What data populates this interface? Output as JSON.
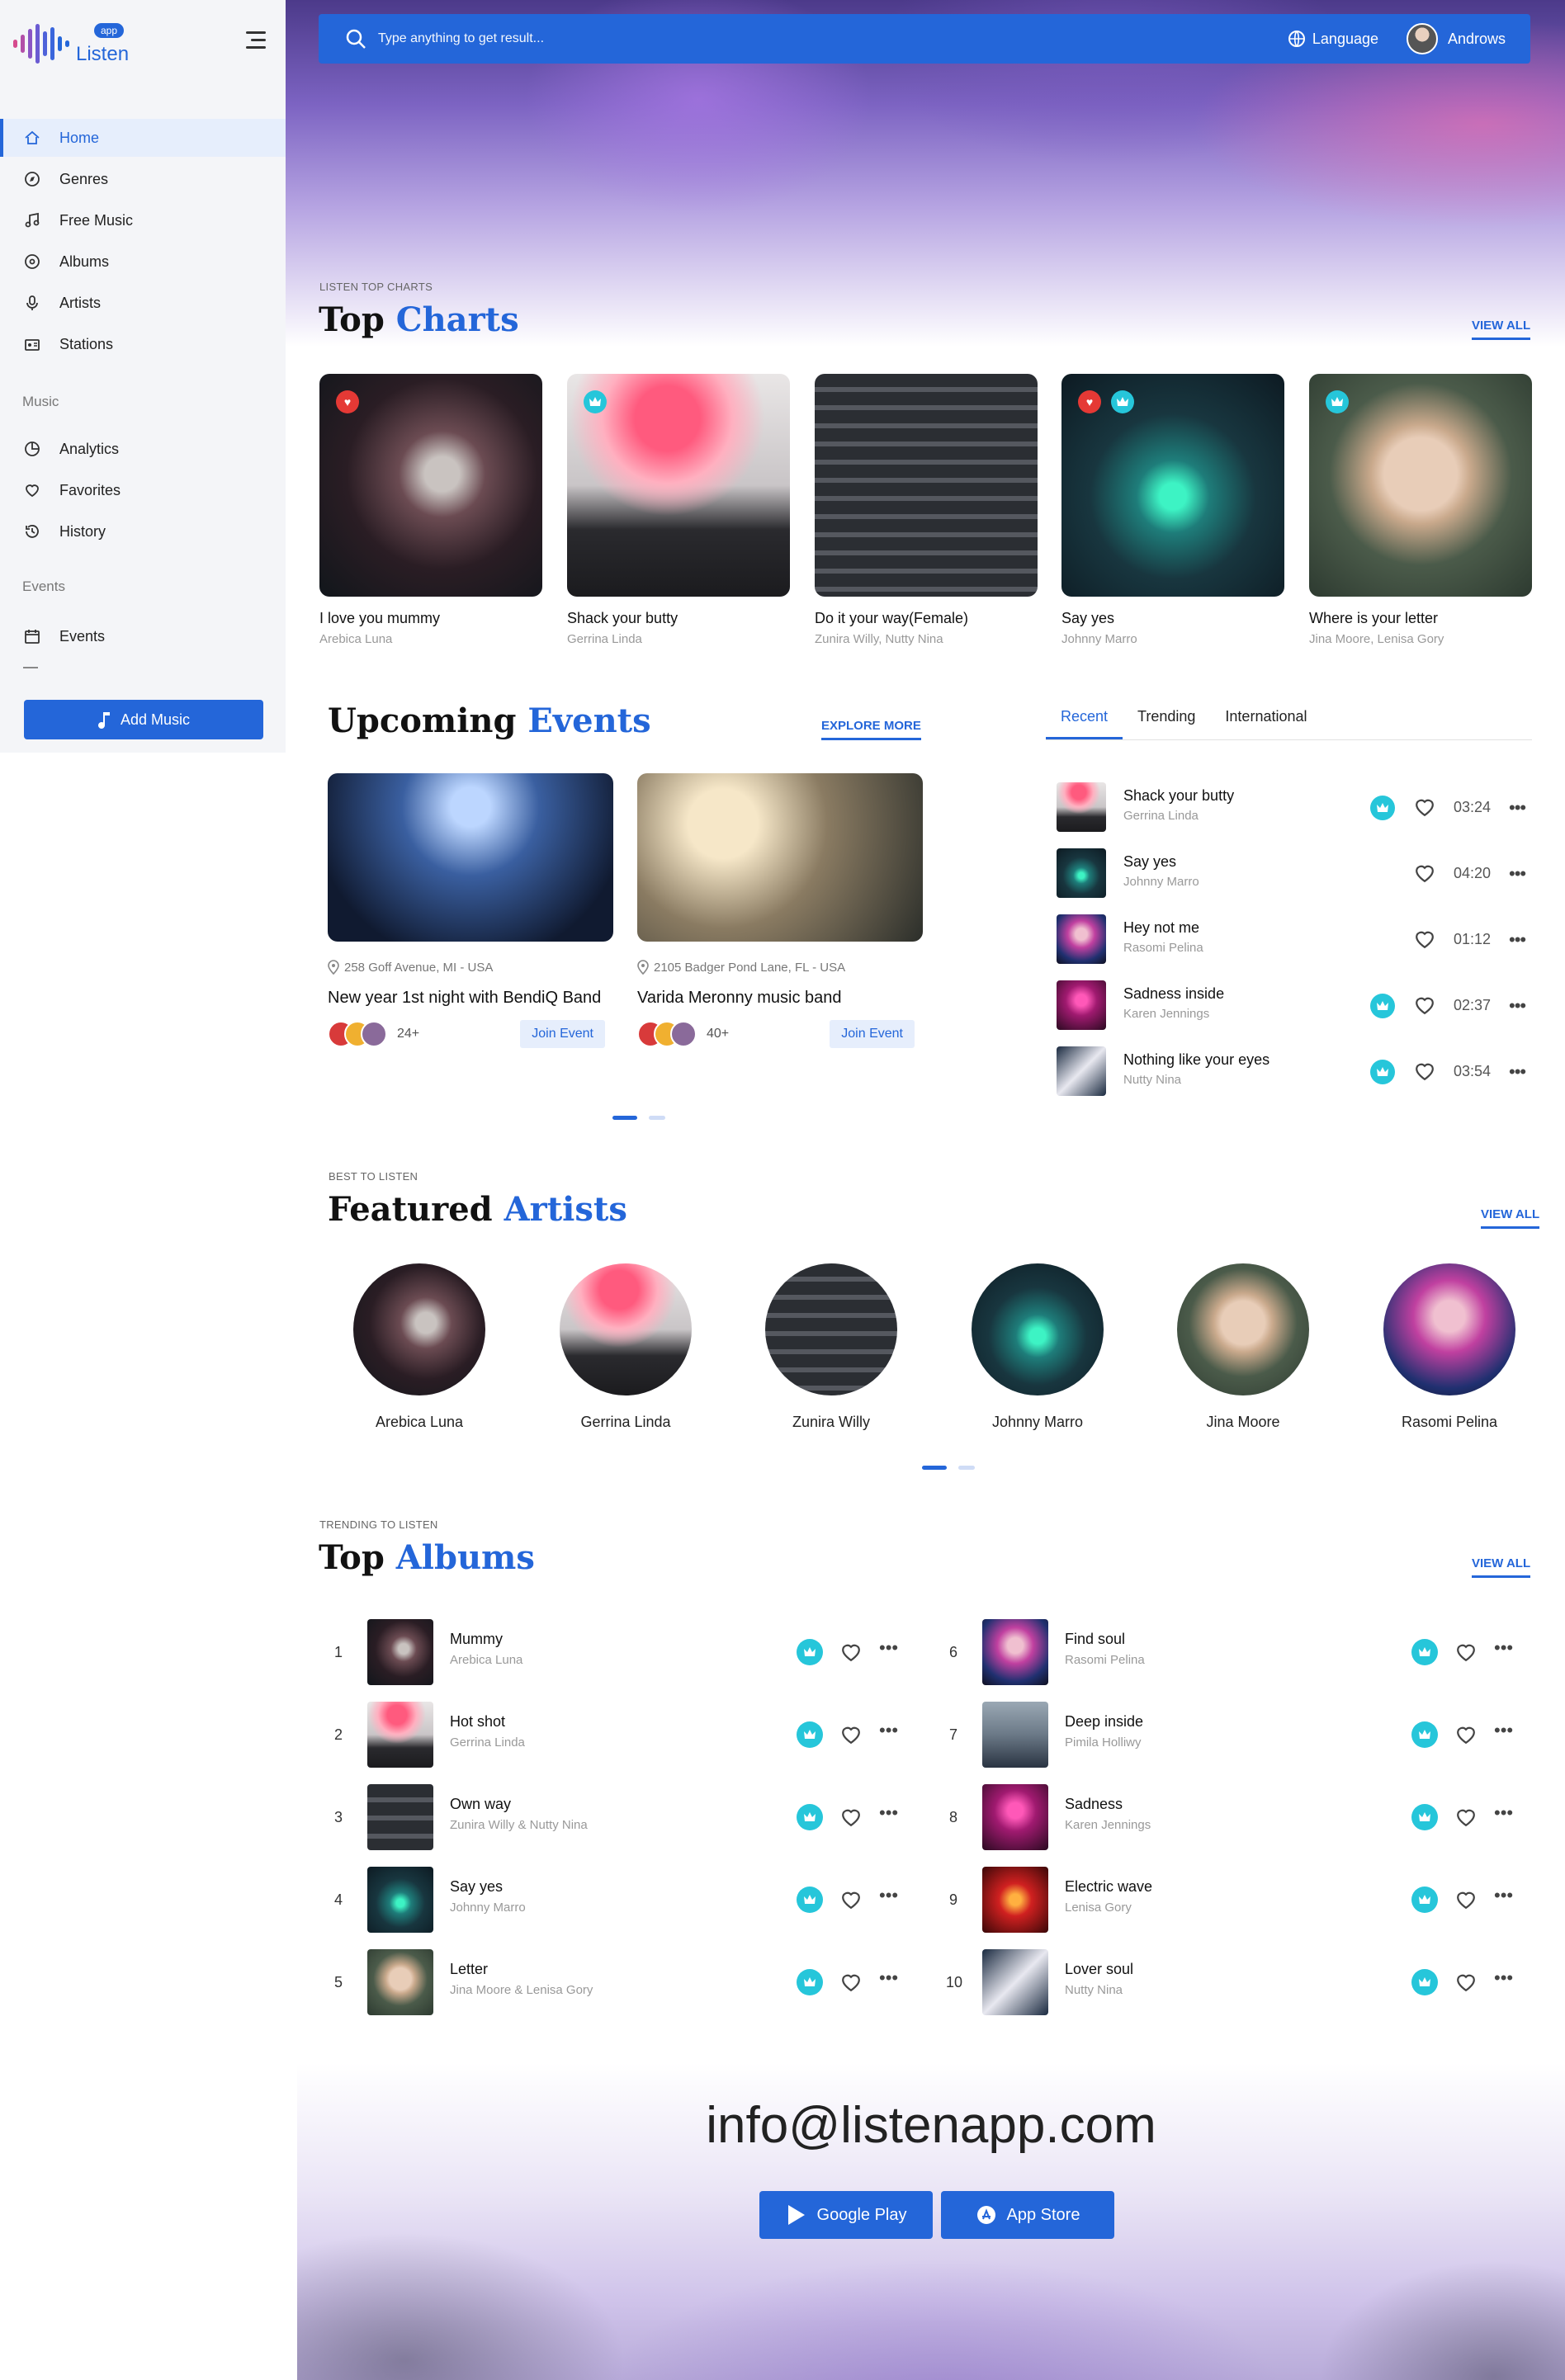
{
  "brand": {
    "badge": "app",
    "name": "Listen"
  },
  "sidebar": {
    "items": [
      {
        "label": "Home",
        "icon": "home-icon"
      },
      {
        "label": "Genres",
        "icon": "compass-icon"
      },
      {
        "label": "Free Music",
        "icon": "music-note-icon"
      },
      {
        "label": "Albums",
        "icon": "disc-icon"
      },
      {
        "label": "Artists",
        "icon": "microphone-icon"
      },
      {
        "label": "Stations",
        "icon": "radio-icon"
      }
    ],
    "music_title": "Music",
    "music_items": [
      {
        "label": "Analytics",
        "icon": "pie-chart-icon"
      },
      {
        "label": "Favorites",
        "icon": "heart-icon"
      },
      {
        "label": "History",
        "icon": "history-icon"
      }
    ],
    "events_title": "Events",
    "events_items": [
      {
        "label": "Events",
        "icon": "calendar-icon"
      }
    ],
    "add_music": "Add Music"
  },
  "header": {
    "search_placeholder": "Type anything to get result...",
    "language": "Language",
    "user": "Androws"
  },
  "top_charts": {
    "kicker": "LISTEN TOP CHARTS",
    "title_a": "Top",
    "title_b": "Charts",
    "view_all": "VIEW ALL",
    "cards": [
      {
        "title": "I love you mummy",
        "sub": "Arebica Luna",
        "tags": [
          "heart"
        ]
      },
      {
        "title": "Shack your butty",
        "sub": "Gerrina Linda",
        "tags": [
          "crown"
        ]
      },
      {
        "title": "Do it your way(Female)",
        "sub": "Zunira Willy, Nutty Nina",
        "tags": []
      },
      {
        "title": "Say yes",
        "sub": "Johnny Marro",
        "tags": [
          "heart",
          "crown"
        ]
      },
      {
        "title": "Where is your letter",
        "sub": "Jina Moore, Lenisa Gory",
        "tags": [
          "crown"
        ]
      }
    ]
  },
  "events": {
    "title_a": "Upcoming",
    "title_b": "Events",
    "explore": "EXPLORE MORE",
    "items": [
      {
        "location": "258 Goff Avenue, MI - USA",
        "name": "New year 1st night with BendiQ Band",
        "count": "24+",
        "join": "Join Event"
      },
      {
        "location": "2105 Badger Pond Lane, FL - USA",
        "name": "Varida Meronny music band",
        "count": "40+",
        "join": "Join Event"
      }
    ]
  },
  "tabs": [
    "Recent",
    "Trending",
    "International"
  ],
  "recent": [
    {
      "title": "Shack your butty",
      "sub": "Gerrina Linda",
      "time": "03:24",
      "crown": true
    },
    {
      "title": "Say yes",
      "sub": "Johnny Marro",
      "time": "04:20",
      "crown": false
    },
    {
      "title": "Hey not me",
      "sub": "Rasomi Pelina",
      "time": "01:12",
      "crown": false
    },
    {
      "title": "Sadness inside",
      "sub": "Karen Jennings",
      "time": "02:37",
      "crown": true
    },
    {
      "title": "Nothing like your eyes",
      "sub": "Nutty Nina",
      "time": "03:54",
      "crown": true
    }
  ],
  "artists": {
    "kicker": "BEST TO LISTEN",
    "title_a": "Featured",
    "title_b": "Artists",
    "view_all": "VIEW ALL",
    "items": [
      "Arebica Luna",
      "Gerrina Linda",
      "Zunira Willy",
      "Johnny Marro",
      "Jina Moore",
      "Rasomi Pelina"
    ]
  },
  "albums": {
    "kicker": "TRENDING TO LISTEN",
    "title_a": "Top",
    "title_b": "Albums",
    "view_all": "VIEW ALL",
    "items": [
      {
        "num": "1",
        "title": "Mummy",
        "sub": "Arebica Luna"
      },
      {
        "num": "2",
        "title": "Hot shot",
        "sub": "Gerrina Linda"
      },
      {
        "num": "3",
        "title": "Own way",
        "sub": "Zunira Willy & Nutty Nina"
      },
      {
        "num": "4",
        "title": "Say yes",
        "sub": "Johnny Marro"
      },
      {
        "num": "5",
        "title": "Letter",
        "sub": "Jina Moore & Lenisa Gory"
      },
      {
        "num": "6",
        "title": "Find soul",
        "sub": "Rasomi Pelina"
      },
      {
        "num": "7",
        "title": "Deep inside",
        "sub": "Pimila Holliwy"
      },
      {
        "num": "8",
        "title": "Sadness",
        "sub": "Karen Jennings"
      },
      {
        "num": "9",
        "title": "Electric wave",
        "sub": "Lenisa Gory"
      },
      {
        "num": "10",
        "title": "Lover soul",
        "sub": "Nutty Nina"
      }
    ]
  },
  "footer": {
    "email": "info@listenapp.com",
    "google_play": "Google Play",
    "app_store": "App Store"
  },
  "colors": {
    "accent": "#2466d9",
    "crown": "#26c6da",
    "heart": "#e53935"
  }
}
